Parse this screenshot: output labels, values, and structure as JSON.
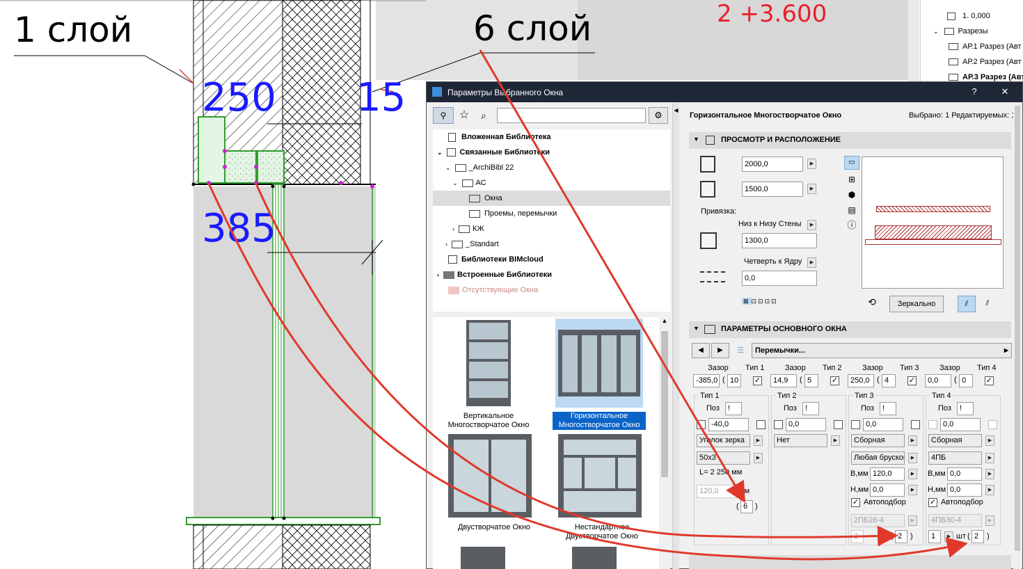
{
  "drawing": {
    "layer1_label": "1 слой",
    "layer6_label": "6 слой",
    "level_label": "2 +3.600",
    "dim_250": "250",
    "dim_15": "15",
    "dim_385": "385"
  },
  "project_tree": {
    "items": [
      {
        "label": "1. 0,000"
      },
      {
        "label": "Разрезы"
      },
      {
        "label": "АР.1 Разрез (Авт"
      },
      {
        "label": "АР.2 Разрез (Авт"
      },
      {
        "label": "АР.3 Разрез (Авт"
      }
    ]
  },
  "dialog": {
    "title": "Параметры Выбранного Окна",
    "help_label": "?",
    "close_label": "✕",
    "search": {
      "value": ""
    },
    "libraries": [
      {
        "label": "Вложенная Библиотека"
      },
      {
        "label": "Связанные Библиотеки"
      },
      {
        "label": "_ArchiBibl 22"
      },
      {
        "label": "АС"
      },
      {
        "label": "Окна"
      },
      {
        "label": "Проемы, перемычки"
      },
      {
        "label": "КЖ"
      },
      {
        "label": "_Standart"
      },
      {
        "label": "Библиотеки BIMcloud"
      },
      {
        "label": "Встроенные Библиотеки"
      },
      {
        "label": "Отсутствующие Окна"
      }
    ],
    "thumbnails": [
      {
        "caption": "Вертикальное Многостворчатое Окно"
      },
      {
        "caption": "Горизонтальное Многостворчатое Окно"
      },
      {
        "caption": "Двустворчатое Окно"
      },
      {
        "caption": "Нестандартное Двустворчатое Окно"
      }
    ],
    "object_name": "Горизонтальное Многостворчатое Окно",
    "selection_info": "Выбрано: 1 Редактируемых: 1",
    "preview_section": {
      "title": "ПРОСМОТР И РАСПОЛОЖЕНИЕ",
      "width": "2000,0",
      "height": "1500,0",
      "anchor_label": "Привязка:",
      "anchor_mode": "Низ к Низу Стены",
      "anchor_value": "1300,0",
      "reveal_mode": "Четверть к Ядру",
      "reveal_value": "0,0",
      "mirror_label": "Зеркально"
    },
    "params_section": {
      "title": "ПАРАМЕТРЫ ОСНОВНОГО ОКНА",
      "page_select": "Перемычки...",
      "gap_label": "Зазор",
      "types": [
        {
          "type_label": "Тип 1",
          "gap": "-385,0",
          "count": "10",
          "pos_label": "Поз",
          "offset": "-40,0",
          "kind": "Уголок зерка",
          "profile": "50x3",
          "length_label": "L= 2 250 мм",
          "mm_value": "120,0",
          "mm_label": "мм",
          "count_value": "6"
        },
        {
          "type_label": "Тип 2",
          "gap": "14,9",
          "count": "5",
          "pos_label": "Поз",
          "offset": "0,0",
          "kind": "Нет"
        },
        {
          "type_label": "Тип 3",
          "gap": "250,0",
          "count": "4",
          "pos_label": "Поз",
          "offset": "0,0",
          "kind": "Сборная",
          "profile": "Любая брусков",
          "b_label": "В,мм",
          "b_value": "120,0",
          "h_label": "Н,мм",
          "h_value": "0,0",
          "auto_label": "Автоподбор",
          "mark": "2ПБ26-4",
          "qty_a": "2",
          "qty_label": "шт",
          "qty_b": "2"
        },
        {
          "type_label": "Тип 4",
          "gap": "0,0",
          "count": "0",
          "pos_label": "Поз",
          "offset": "0,0",
          "kind": "Сборная",
          "profile": "4ПБ",
          "b_label": "В,мм",
          "b_value": "0,0",
          "h_label": "Н,мм",
          "h_value": "0,0",
          "auto_label": "Автоподбор",
          "mark": "4ПБ30-4",
          "qty_a": "1",
          "qty_label": "шт",
          "qty_b": "2"
        }
      ]
    }
  },
  "colors": {
    "annotation_arrow": "#e0392b",
    "dimension_blue": "#1a1aff",
    "level_red": "#e8202a",
    "selection_green": "#2e9e2e",
    "titlebar": "#1f2736",
    "accent_blue": "#0a64c8"
  }
}
